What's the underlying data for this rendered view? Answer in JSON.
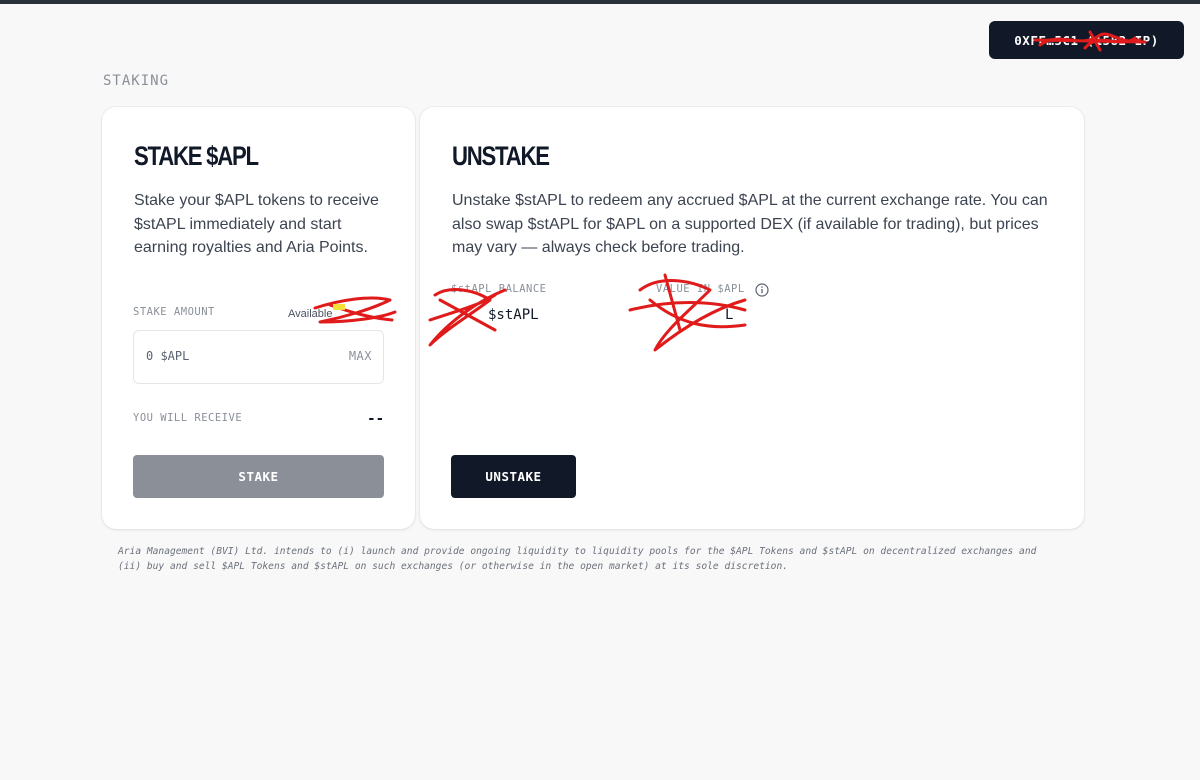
{
  "header": {
    "wallet_label": "0XFF…5C1 (1582 IP)"
  },
  "section": {
    "label": "STAKING"
  },
  "stake_card": {
    "title": "STAKE $APL",
    "description": "Stake your $APL tokens to receive $stAPL immediately and start earning royalties and Aria Points.",
    "amount_label": "STAKE AMOUNT",
    "available_label": "Available",
    "input_placeholder": "0 $APL",
    "max_label": "MAX",
    "receive_label": "YOU WILL RECEIVE",
    "receive_value": "--",
    "button_label": "STAKE"
  },
  "unstake_card": {
    "title": "UNSTAKE",
    "description": "Unstake $stAPL to redeem any accrued $APL at the current exchange rate. You can also swap $stAPL for $APL on a supported DEX (if available for trading), but prices may vary — always check before trading.",
    "balance_label": "$stAPL BALANCE",
    "balance_value": "$stAPL",
    "value_label": "VALUE IN $APL",
    "value_value": "L",
    "button_label": "UNSTAKE"
  },
  "disclaimer": "Aria Management (BVI) Ltd. intends to (i) launch and provide ongoing liquidity to liquidity pools for the $APL Tokens and $stAPL on decentralized exchanges and (ii) buy and sell $APL Tokens and $stAPL on such exchanges (or otherwise in the open market) at its sole discretion.",
  "icons": {
    "info": "info-icon"
  },
  "colors": {
    "accent_dark": "#111827",
    "disabled_button": "#8b9098",
    "background": "#f8f8f8",
    "redaction": "#e01b1b"
  }
}
